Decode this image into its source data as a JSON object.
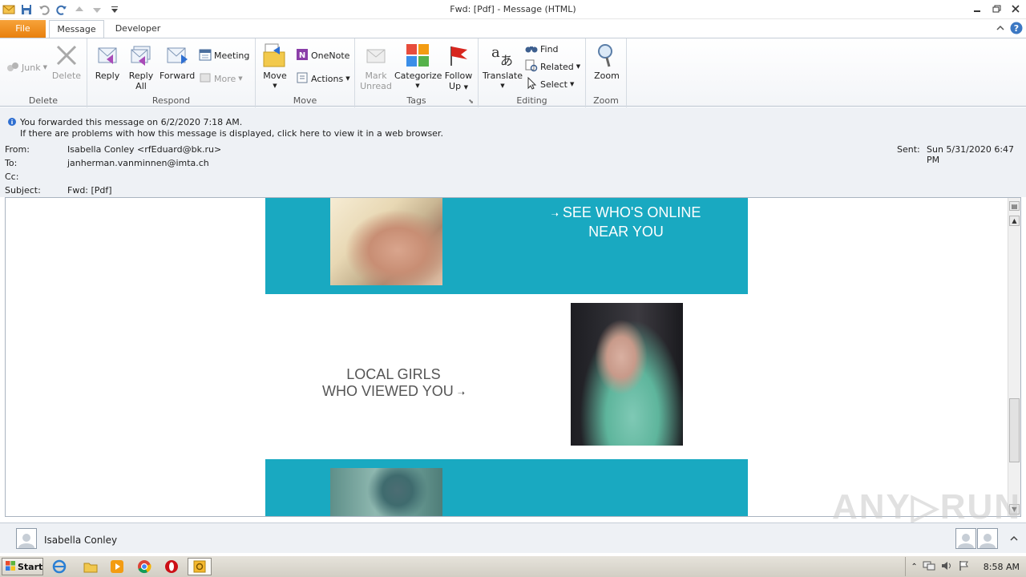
{
  "window": {
    "title": "Fwd: [Pdf]   -  Message (HTML)"
  },
  "tabs": {
    "file": "File",
    "message": "Message",
    "developer": "Developer"
  },
  "ribbon": {
    "delete_group": {
      "label": "Delete",
      "junk": "Junk",
      "delete": "Delete"
    },
    "respond_group": {
      "label": "Respond",
      "reply": "Reply",
      "reply_all_1": "Reply",
      "reply_all_2": "All",
      "forward": "Forward",
      "meeting": "Meeting",
      "more": "More"
    },
    "move_group": {
      "label": "Move",
      "move": "Move",
      "onenote": "OneNote",
      "actions": "Actions"
    },
    "tags_group": {
      "label": "Tags",
      "mark_unread_1": "Mark",
      "mark_unread_2": "Unread",
      "categorize": "Categorize",
      "follow_up_1": "Follow",
      "follow_up_2": "Up"
    },
    "editing_group": {
      "label": "Editing",
      "translate": "Translate",
      "find": "Find",
      "related": "Related",
      "select": "Select"
    },
    "zoom_group": {
      "label": "Zoom",
      "zoom": "Zoom"
    }
  },
  "info": {
    "forwarded": "You forwarded this message on 6/2/2020 7:18 AM.",
    "problems": "If there are problems with how this message is displayed, click here to view it in a web browser."
  },
  "headers": {
    "from_label": "From:",
    "from_value": "Isabella Conley <rfEduard@bk.ru>",
    "to_label": "To:",
    "to_value": "janherman.vanminnen@imta.ch",
    "cc_label": "Cc:",
    "subject_label": "Subject:",
    "subject_value": "Fwd: [Pdf]",
    "sent_label": "Sent:",
    "sent_value": "Sun 5/31/2020 6:47 PM"
  },
  "email": {
    "cta_online_1": "SEE WHO'S ONLINE",
    "cta_online_2": "NEAR YOU",
    "cta_viewed_1": "LOCAL GIRLS",
    "cta_viewed_2": "WHO VIEWED YOU"
  },
  "people_pane": {
    "name": "Isabella Conley"
  },
  "taskbar": {
    "start": "Start",
    "clock": "8:58 AM"
  },
  "watermark": "ANY RUN",
  "colors": {
    "accent_teal": "#19a9c1",
    "file_tab": "#e8800e"
  }
}
